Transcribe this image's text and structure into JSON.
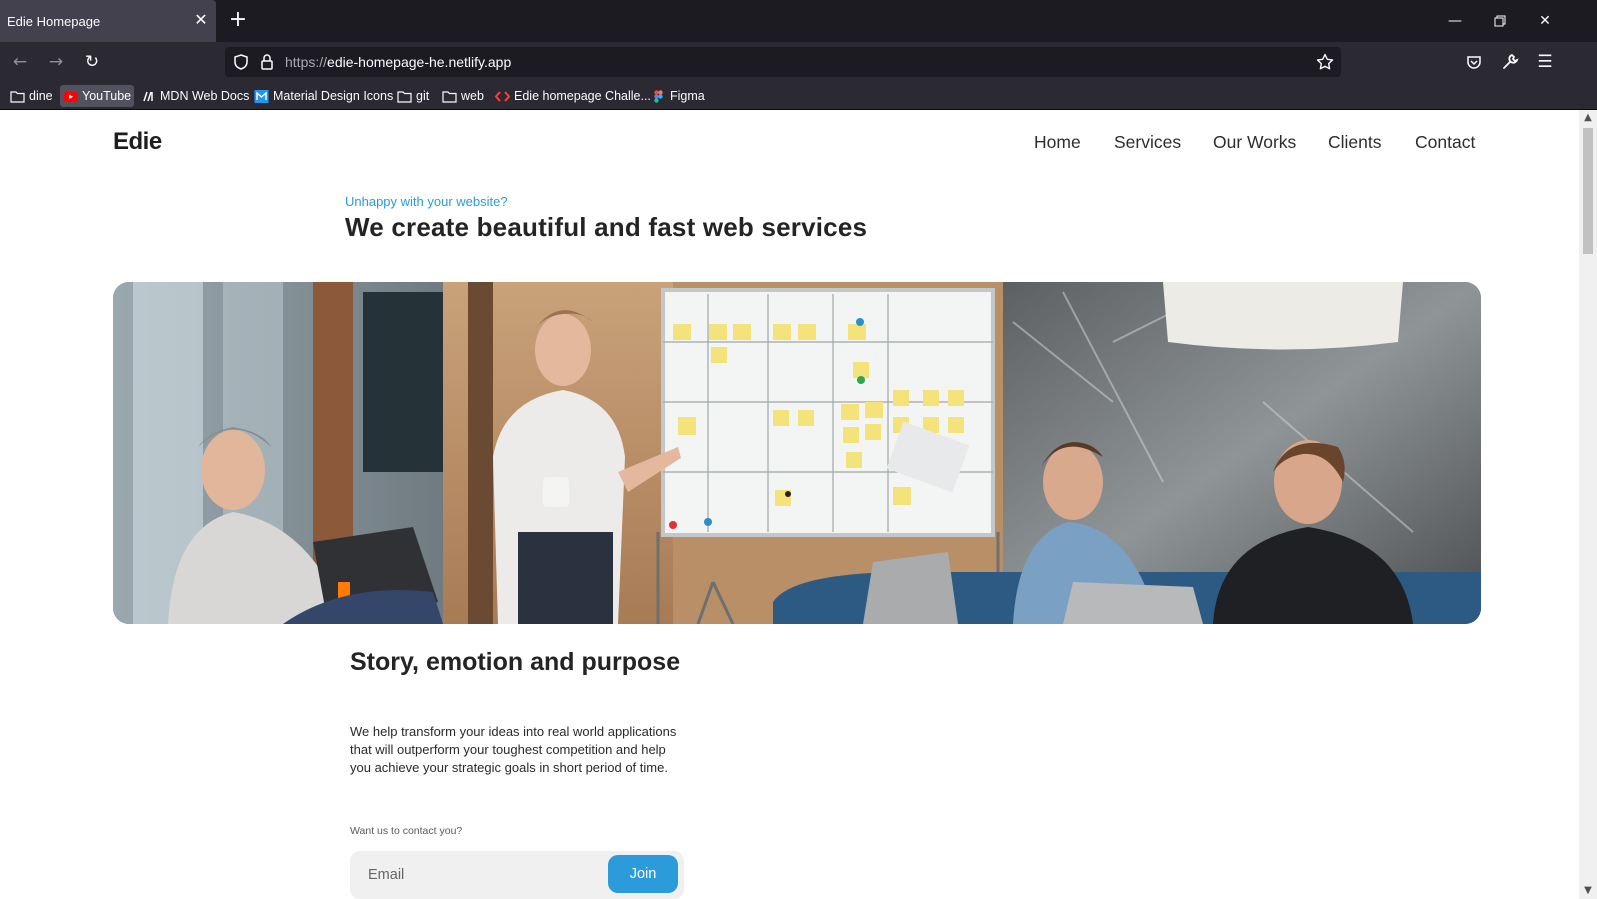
{
  "browser": {
    "tab_title": "Edie Homepage",
    "url_scheme": "https://",
    "url_host": "edie-homepage-he.netlify.app",
    "bookmarks": [
      {
        "label": "dine",
        "icon": "folder-icon"
      },
      {
        "label": "YouTube",
        "icon": "youtube-icon"
      },
      {
        "label": "MDN Web Docs",
        "icon": "mdn-icon"
      },
      {
        "label": "Material Design Icons",
        "icon": "mdi-icon"
      },
      {
        "label": "git",
        "icon": "folder-icon"
      },
      {
        "label": "web",
        "icon": "folder-icon"
      },
      {
        "label": "Edie homepage Challe...",
        "icon": "frontend-mentor-icon"
      },
      {
        "label": "Figma",
        "icon": "figma-icon"
      }
    ]
  },
  "site": {
    "logo": "Edie",
    "nav": [
      "Home",
      "Services",
      "Our Works",
      "Clients",
      "Contact"
    ],
    "eyebrow": "Unhappy with your website?",
    "headline": "We create beautiful and fast web services",
    "story_title": "Story, emotion and purpose",
    "story_body": "We help transform your ideas into real world applications that will outperform your toughest competition and help you achieve your strategic goals in short period of time.",
    "contact_label": "Want us to contact you?",
    "email_placeholder": "Email",
    "join_label": "Join"
  },
  "colors": {
    "accent": "#2b9bd9",
    "chrome_dark": "#1c1b22",
    "chrome_toolbar": "#2b2a33"
  }
}
